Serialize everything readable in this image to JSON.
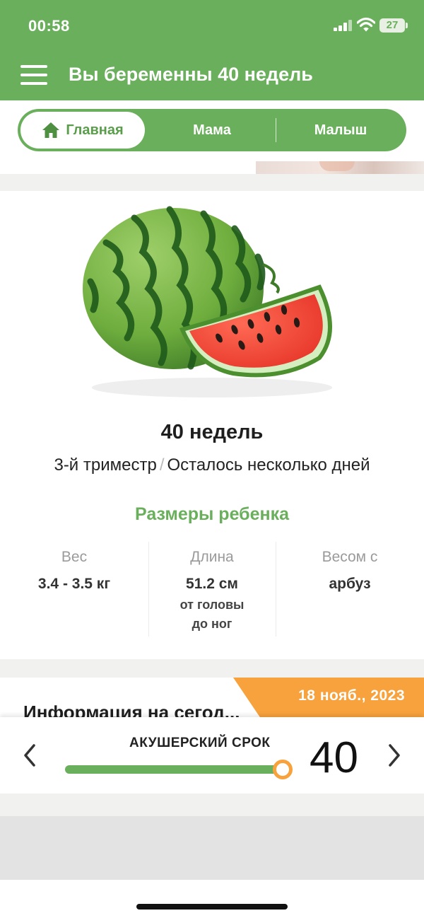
{
  "status_bar": {
    "time": "00:58",
    "battery": "27"
  },
  "app_bar": {
    "title": "Вы беременны 40 недель"
  },
  "tabs": [
    {
      "label": "Главная",
      "icon": "home-icon",
      "active": true
    },
    {
      "label": "Мама",
      "active": false
    },
    {
      "label": "Малыш",
      "active": false
    }
  ],
  "week_card": {
    "image": "watermelon-illustration",
    "title": "40 недель",
    "trimester": "3-й триместр",
    "separator": "/",
    "remaining": "Осталось несколько дней",
    "sizes_title": "Размеры ребенка",
    "columns": [
      {
        "header": "Вес",
        "value": "3.4 - 3.5 кг",
        "sub1": "",
        "sub2": ""
      },
      {
        "header": "Длина",
        "value": "51.2 см",
        "sub1": "от головы",
        "sub2": "до ног"
      },
      {
        "header": "Весом с",
        "value": "арбуз",
        "sub1": "",
        "sub2": ""
      }
    ]
  },
  "info_card": {
    "date": "18 нояб., 2023",
    "title": "Информация на сегод..."
  },
  "week_selector": {
    "label": "АКУШЕРСКИЙ СРОК",
    "week": "40",
    "progress": 1.0
  },
  "colors": {
    "primary_green": "#6aaf5c",
    "accent_orange": "#f7a23c"
  }
}
